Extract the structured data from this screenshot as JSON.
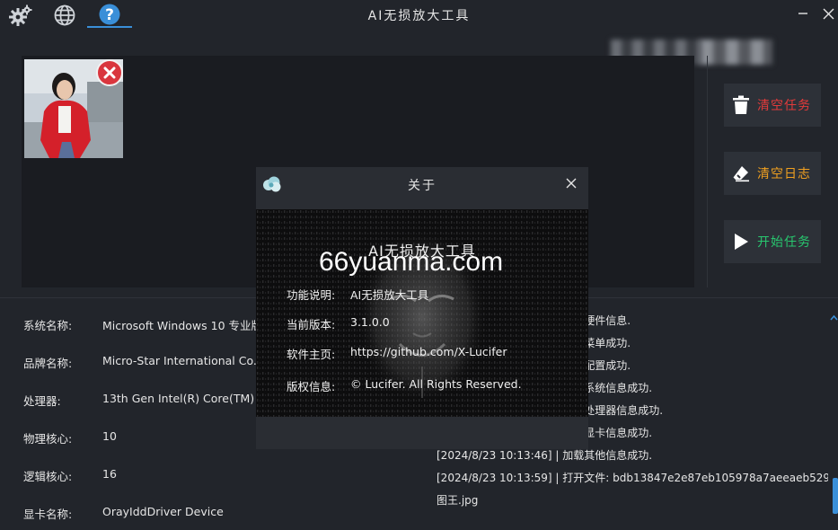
{
  "app": {
    "title": "AI无损放大工具"
  },
  "toolbar": {
    "icons": [
      "gear-icon",
      "globe-icon",
      "help-icon"
    ]
  },
  "actions": {
    "clear_tasks": "清空任务",
    "clear_log": "清空日志",
    "start_task": "开始任务",
    "colors": {
      "clear_tasks": "#e23b3b",
      "clear_log": "#f0a020",
      "start_task": "#28c76f"
    }
  },
  "system_info": [
    {
      "label": "系统名称:",
      "value": "Microsoft Windows 10 专业版"
    },
    {
      "label": "品牌名称:",
      "value": "Micro-Star International Co., Ltd."
    },
    {
      "label": "处理器:",
      "value": "13th Gen Intel(R) Core(TM) i5-13600KF"
    },
    {
      "label": "物理核心:",
      "value": "10"
    },
    {
      "label": "逻辑核心:",
      "value": "16"
    },
    {
      "label": "显卡名称:",
      "value": "OrayIddDriver Device"
    }
  ],
  "log": [
    "[2024/8/23 10:13:45] | 加载硬件信息.",
    "[2024/8/23 10:13:45] | 加载菜单成功.",
    "[2024/8/23 10:13:45] | 加载配置成功.",
    "[2024/8/23 10:13:46] | 加载系统信息成功.",
    "[2024/8/23 10:13:46] | 加载处理器信息成功.",
    "[2024/8/23 10:13:46] | 加载显卡信息成功.",
    "[2024/8/23 10:13:46] | 加载其他信息成功.",
    "[2024/8/23 10:13:59] | 打开文件: bdb13847e2e87eb105978a7aeeaeb529_看",
    "图王.jpg"
  ],
  "about": {
    "title": "关于",
    "app_name": "AI无损放大工具",
    "watermark": "66yuanma.com",
    "rows": [
      {
        "label": "功能说明:",
        "value": "AI无损放大工具"
      },
      {
        "label": "当前版本:",
        "value": "3.1.0.0"
      },
      {
        "label": "软件主页:",
        "value": "https://github.com/X-Lucifer"
      },
      {
        "label": "版权信息:",
        "value": "© Lucifer. All Rights Reserved."
      }
    ]
  }
}
